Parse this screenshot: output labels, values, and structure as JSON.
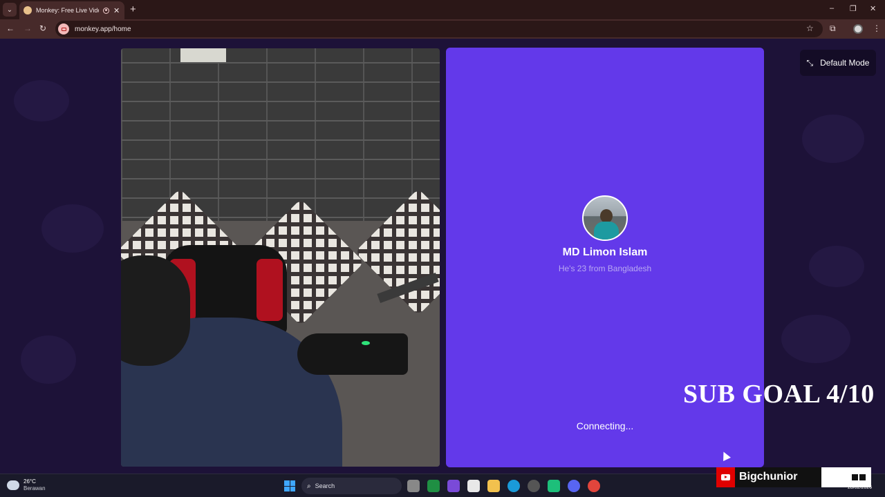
{
  "browser": {
    "tab_title": "Monkey: Free Live Video Ch",
    "new_tab": "+",
    "url": "monkey.app/home",
    "window_controls": [
      "–",
      "❐",
      "✕"
    ]
  },
  "icons": {
    "tab_menu": "chevron-down-icon",
    "back": "arrow-left-icon",
    "forward": "arrow-right-icon",
    "reload": "reload-icon",
    "bookmark": "star-icon",
    "extensions": "puzzle-icon",
    "menu": "kebab-icon"
  },
  "remote": {
    "name": "MD Limon Islam",
    "info": "He's 23 from Bangladesh",
    "status": "Connecting..."
  },
  "mode_button": {
    "label": "Default Mode"
  },
  "overlay": {
    "sub_goal": "SUB GOAL 4/10",
    "channel_name": "Bigchunior"
  },
  "taskbar": {
    "temp": "26°C",
    "condition": "Berawan",
    "search_label": "Search",
    "date": "28/02/2026"
  },
  "colors": {
    "page_bg": "#1d1238",
    "panel_purple": "#6339ea",
    "chrome_dark": "#2b1717",
    "chrome": "#472a2a"
  }
}
